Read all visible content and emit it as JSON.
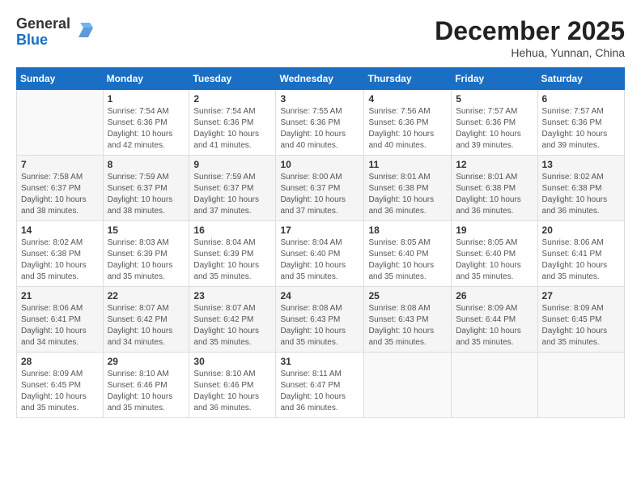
{
  "logo": {
    "general": "General",
    "blue": "Blue"
  },
  "title": "December 2025",
  "location": "Hehua, Yunnan, China",
  "days_of_week": [
    "Sunday",
    "Monday",
    "Tuesday",
    "Wednesday",
    "Thursday",
    "Friday",
    "Saturday"
  ],
  "weeks": [
    [
      {
        "day": "",
        "sunrise": "",
        "sunset": "",
        "daylight": ""
      },
      {
        "day": "1",
        "sunrise": "Sunrise: 7:54 AM",
        "sunset": "Sunset: 6:36 PM",
        "daylight": "Daylight: 10 hours and 42 minutes."
      },
      {
        "day": "2",
        "sunrise": "Sunrise: 7:54 AM",
        "sunset": "Sunset: 6:36 PM",
        "daylight": "Daylight: 10 hours and 41 minutes."
      },
      {
        "day": "3",
        "sunrise": "Sunrise: 7:55 AM",
        "sunset": "Sunset: 6:36 PM",
        "daylight": "Daylight: 10 hours and 40 minutes."
      },
      {
        "day": "4",
        "sunrise": "Sunrise: 7:56 AM",
        "sunset": "Sunset: 6:36 PM",
        "daylight": "Daylight: 10 hours and 40 minutes."
      },
      {
        "day": "5",
        "sunrise": "Sunrise: 7:57 AM",
        "sunset": "Sunset: 6:36 PM",
        "daylight": "Daylight: 10 hours and 39 minutes."
      },
      {
        "day": "6",
        "sunrise": "Sunrise: 7:57 AM",
        "sunset": "Sunset: 6:36 PM",
        "daylight": "Daylight: 10 hours and 39 minutes."
      }
    ],
    [
      {
        "day": "7",
        "sunrise": "Sunrise: 7:58 AM",
        "sunset": "Sunset: 6:37 PM",
        "daylight": "Daylight: 10 hours and 38 minutes."
      },
      {
        "day": "8",
        "sunrise": "Sunrise: 7:59 AM",
        "sunset": "Sunset: 6:37 PM",
        "daylight": "Daylight: 10 hours and 38 minutes."
      },
      {
        "day": "9",
        "sunrise": "Sunrise: 7:59 AM",
        "sunset": "Sunset: 6:37 PM",
        "daylight": "Daylight: 10 hours and 37 minutes."
      },
      {
        "day": "10",
        "sunrise": "Sunrise: 8:00 AM",
        "sunset": "Sunset: 6:37 PM",
        "daylight": "Daylight: 10 hours and 37 minutes."
      },
      {
        "day": "11",
        "sunrise": "Sunrise: 8:01 AM",
        "sunset": "Sunset: 6:38 PM",
        "daylight": "Daylight: 10 hours and 36 minutes."
      },
      {
        "day": "12",
        "sunrise": "Sunrise: 8:01 AM",
        "sunset": "Sunset: 6:38 PM",
        "daylight": "Daylight: 10 hours and 36 minutes."
      },
      {
        "day": "13",
        "sunrise": "Sunrise: 8:02 AM",
        "sunset": "Sunset: 6:38 PM",
        "daylight": "Daylight: 10 hours and 36 minutes."
      }
    ],
    [
      {
        "day": "14",
        "sunrise": "Sunrise: 8:02 AM",
        "sunset": "Sunset: 6:38 PM",
        "daylight": "Daylight: 10 hours and 35 minutes."
      },
      {
        "day": "15",
        "sunrise": "Sunrise: 8:03 AM",
        "sunset": "Sunset: 6:39 PM",
        "daylight": "Daylight: 10 hours and 35 minutes."
      },
      {
        "day": "16",
        "sunrise": "Sunrise: 8:04 AM",
        "sunset": "Sunset: 6:39 PM",
        "daylight": "Daylight: 10 hours and 35 minutes."
      },
      {
        "day": "17",
        "sunrise": "Sunrise: 8:04 AM",
        "sunset": "Sunset: 6:40 PM",
        "daylight": "Daylight: 10 hours and 35 minutes."
      },
      {
        "day": "18",
        "sunrise": "Sunrise: 8:05 AM",
        "sunset": "Sunset: 6:40 PM",
        "daylight": "Daylight: 10 hours and 35 minutes."
      },
      {
        "day": "19",
        "sunrise": "Sunrise: 8:05 AM",
        "sunset": "Sunset: 6:40 PM",
        "daylight": "Daylight: 10 hours and 35 minutes."
      },
      {
        "day": "20",
        "sunrise": "Sunrise: 8:06 AM",
        "sunset": "Sunset: 6:41 PM",
        "daylight": "Daylight: 10 hours and 35 minutes."
      }
    ],
    [
      {
        "day": "21",
        "sunrise": "Sunrise: 8:06 AM",
        "sunset": "Sunset: 6:41 PM",
        "daylight": "Daylight: 10 hours and 34 minutes."
      },
      {
        "day": "22",
        "sunrise": "Sunrise: 8:07 AM",
        "sunset": "Sunset: 6:42 PM",
        "daylight": "Daylight: 10 hours and 34 minutes."
      },
      {
        "day": "23",
        "sunrise": "Sunrise: 8:07 AM",
        "sunset": "Sunset: 6:42 PM",
        "daylight": "Daylight: 10 hours and 35 minutes."
      },
      {
        "day": "24",
        "sunrise": "Sunrise: 8:08 AM",
        "sunset": "Sunset: 6:43 PM",
        "daylight": "Daylight: 10 hours and 35 minutes."
      },
      {
        "day": "25",
        "sunrise": "Sunrise: 8:08 AM",
        "sunset": "Sunset: 6:43 PM",
        "daylight": "Daylight: 10 hours and 35 minutes."
      },
      {
        "day": "26",
        "sunrise": "Sunrise: 8:09 AM",
        "sunset": "Sunset: 6:44 PM",
        "daylight": "Daylight: 10 hours and 35 minutes."
      },
      {
        "day": "27",
        "sunrise": "Sunrise: 8:09 AM",
        "sunset": "Sunset: 6:45 PM",
        "daylight": "Daylight: 10 hours and 35 minutes."
      }
    ],
    [
      {
        "day": "28",
        "sunrise": "Sunrise: 8:09 AM",
        "sunset": "Sunset: 6:45 PM",
        "daylight": "Daylight: 10 hours and 35 minutes."
      },
      {
        "day": "29",
        "sunrise": "Sunrise: 8:10 AM",
        "sunset": "Sunset: 6:46 PM",
        "daylight": "Daylight: 10 hours and 35 minutes."
      },
      {
        "day": "30",
        "sunrise": "Sunrise: 8:10 AM",
        "sunset": "Sunset: 6:46 PM",
        "daylight": "Daylight: 10 hours and 36 minutes."
      },
      {
        "day": "31",
        "sunrise": "Sunrise: 8:11 AM",
        "sunset": "Sunset: 6:47 PM",
        "daylight": "Daylight: 10 hours and 36 minutes."
      },
      {
        "day": "",
        "sunrise": "",
        "sunset": "",
        "daylight": ""
      },
      {
        "day": "",
        "sunrise": "",
        "sunset": "",
        "daylight": ""
      },
      {
        "day": "",
        "sunrise": "",
        "sunset": "",
        "daylight": ""
      }
    ]
  ]
}
